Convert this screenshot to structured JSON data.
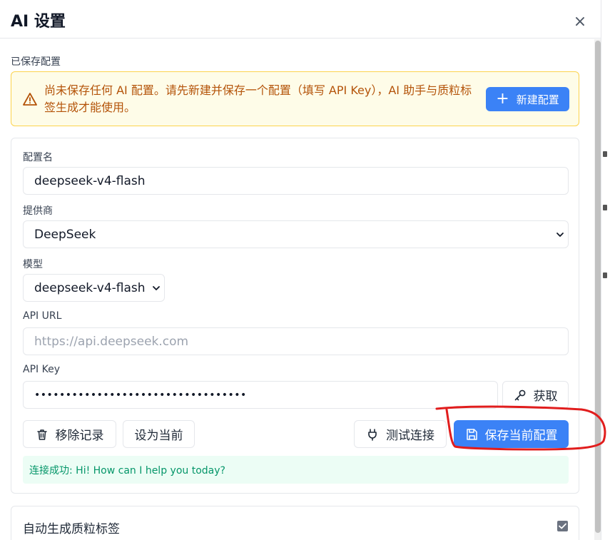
{
  "dialog": {
    "title": "AI 设置",
    "close_glyph": "×"
  },
  "saved": {
    "label": "已保存配置",
    "warning_text": "尚未保存任何 AI 配置。请先新建并保存一个配置（填写 API Key），AI 助手与质粒标签生成才能使用。",
    "new_button": "新建配置"
  },
  "form": {
    "name_label": "配置名",
    "name_value": "deepseek-v4-flash",
    "provider_label": "提供商",
    "provider_value": "DeepSeek",
    "model_label": "模型",
    "model_value": "deepseek-v4-flash",
    "api_url_label": "API URL",
    "api_url_placeholder": "https://api.deepseek.com",
    "api_key_label": "API Key",
    "api_key_value": "••••••••••••••••••••••••••••••••••",
    "get_key_button": "获取",
    "remove_button": "移除记录",
    "set_current_button": "设为当前",
    "test_button": "测试连接",
    "save_button": "保存当前配置",
    "status_text": "连接成功: Hi! How can I help you today?"
  },
  "auto": {
    "label": "自动生成质粒标签",
    "checked": true
  },
  "colors": {
    "primary": "#3b82f6",
    "warning_text": "#b45309",
    "success_text": "#059669",
    "annotation": "#e11d1d"
  },
  "icons": [
    "warning-icon",
    "plus-icon",
    "chevron-down-icon",
    "key-icon",
    "trash-icon",
    "plug-icon",
    "save-icon",
    "close-icon"
  ]
}
